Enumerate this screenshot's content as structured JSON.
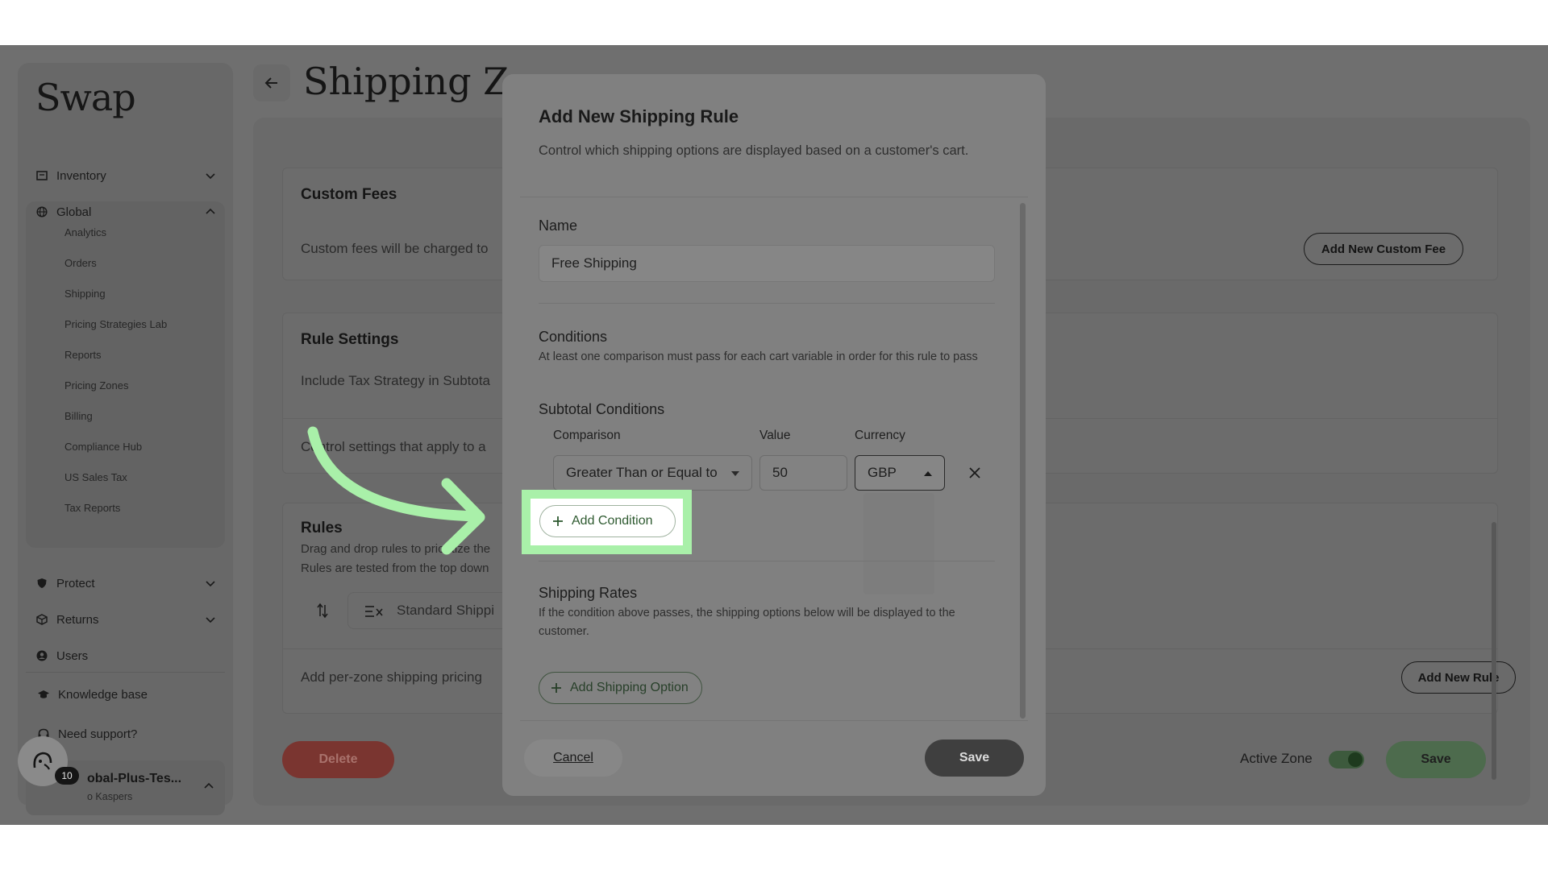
{
  "sidebar": {
    "logo": "Swap",
    "inventory": "Inventory",
    "global": "Global",
    "global_items": [
      "Analytics",
      "Orders",
      "Shipping",
      "Pricing Strategies Lab",
      "Reports",
      "Pricing Zones",
      "Billing",
      "Compliance Hub",
      "US Sales Tax",
      "Tax Reports"
    ],
    "protect": "Protect",
    "returns": "Returns",
    "users": "Users",
    "knowledge_base": "Knowledge base",
    "need_support": "Need support?",
    "user_name": "obal-Plus-Tes...",
    "user_sub": "o Kaspers",
    "badge_count": "10"
  },
  "page": {
    "title": "Shipping Zone",
    "custom_fees_title": "Custom Fees",
    "custom_fees_text": "Custom fees will be charged to",
    "add_custom_fee": "Add New Custom Fee",
    "rule_settings_title": "Rule Settings",
    "include_tax_text": "Include Tax Strategy in Subtota",
    "control_settings_text": "Control settings that apply to a",
    "rules_title": "Rules",
    "rules_text_1": "Drag and drop rules to prioritize the",
    "rules_text_2": "Rules are tested from the top down",
    "standard_shipping": "Standard Shippi",
    "per_zone_text": "Add per-zone shipping pricing",
    "add_new_rule": "Add New Rule",
    "delete": "Delete",
    "active_zone": "Active Zone",
    "save": "Save"
  },
  "modal": {
    "title": "Add New Shipping Rule",
    "description": "Control which shipping options are displayed based on a customer's cart.",
    "name_label": "Name",
    "name_value": "Free Shipping",
    "conditions_label": "Conditions",
    "conditions_desc": "At least one comparison must pass for each cart variable in order for this rule to pass",
    "subtotal_label": "Subtotal Conditions",
    "col_comparison": "Comparison",
    "col_value": "Value",
    "col_currency": "Currency",
    "comparison_value": "Greater Than or Equal to",
    "value_value": "50",
    "currency_value": "GBP",
    "add_condition": "Add Condition",
    "shipping_rates_label": "Shipping Rates",
    "shipping_rates_desc": "If the condition above passes, the shipping options below will be displayed to the customer.",
    "add_shipping_option": "Add Shipping Option",
    "cancel": "Cancel",
    "save": "Save"
  },
  "colors": {
    "highlight": "#a9f0a9",
    "arrow": "#a9f0a9",
    "toggle_on": "#3d5a3d"
  }
}
